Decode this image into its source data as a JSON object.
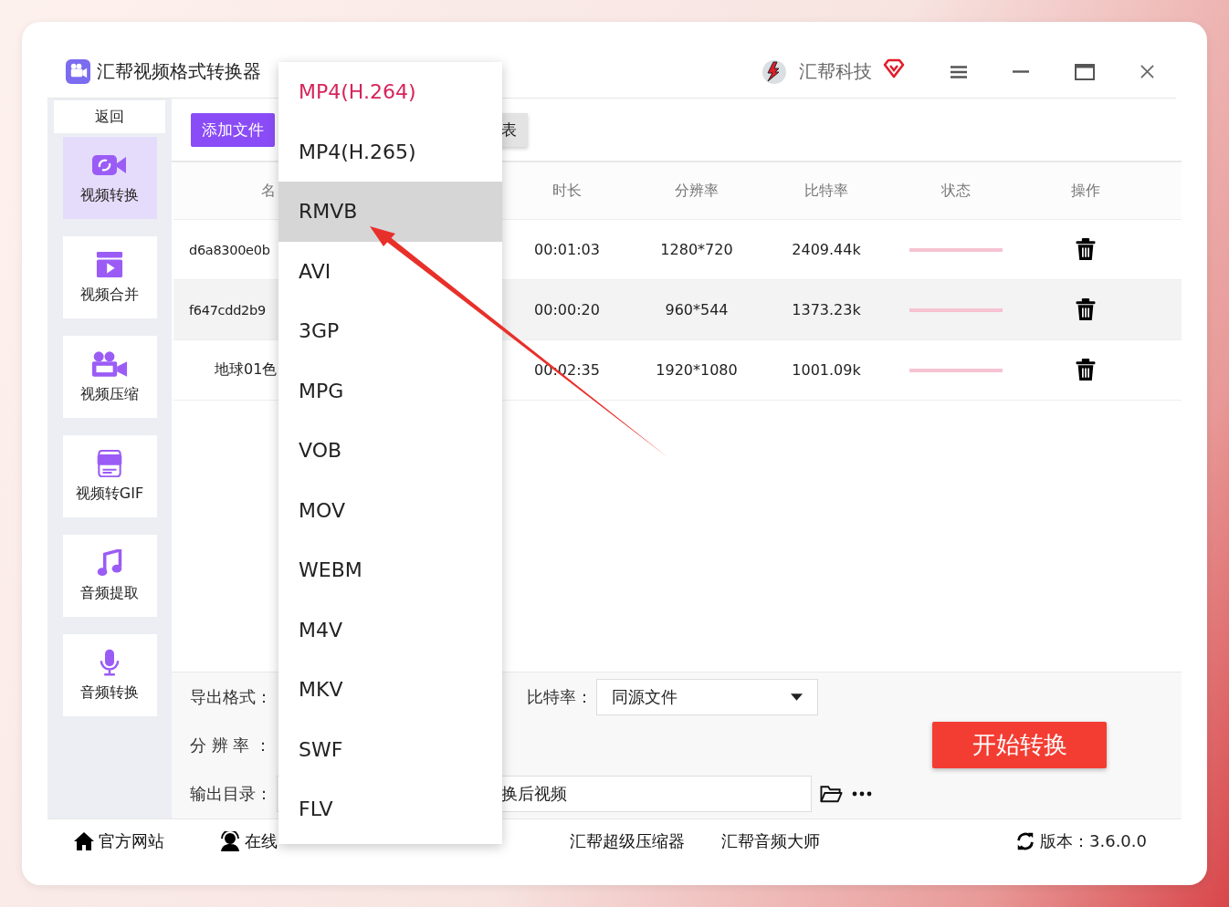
{
  "window": {
    "title": "汇帮视频格式转换器",
    "brand": "汇帮科技"
  },
  "sidebar": {
    "back": "返回",
    "items": [
      {
        "label": "视频转换",
        "kind": "convert",
        "selected": true
      },
      {
        "label": "视频合并",
        "kind": "merge",
        "selected": false
      },
      {
        "label": "视频压缩",
        "kind": "camera",
        "selected": false
      },
      {
        "label": "视频转GIF",
        "kind": "gif",
        "selected": false
      },
      {
        "label": "音频提取",
        "kind": "music",
        "selected": false
      },
      {
        "label": "音频转换",
        "kind": "mic",
        "selected": false
      }
    ]
  },
  "toolbar": {
    "buttons": [
      {
        "label": "添加文件",
        "kind": "primary"
      },
      {
        "label": "表",
        "kind": "secondary"
      }
    ]
  },
  "table": {
    "columns": [
      "名",
      "时长",
      "分辨率",
      "比特率",
      "状态",
      "操作"
    ],
    "rows": [
      {
        "name": "d6a8300e0b",
        "duration": "00:01:03",
        "resolution": "1280*720",
        "bitrate": "2409.44k"
      },
      {
        "name": "f647cdd2b9",
        "duration": "00:00:20",
        "resolution": "960*544",
        "bitrate": "1373.23k"
      },
      {
        "name": "地球01色",
        "duration": "00:02:35",
        "resolution": "1920*1080",
        "bitrate": "1001.09k"
      }
    ]
  },
  "settings": {
    "format_label": "导出格式：",
    "bitrate_label": "比特率：",
    "bitrate_value": "同源文件",
    "resolution_label": "分 辨 率 ：",
    "output_label": "输出目录：",
    "output_value": "换后视频",
    "start": "开始转换"
  },
  "footer": {
    "links": [
      {
        "label": "官方网站",
        "kind": "home"
      },
      {
        "label": "在线",
        "kind": "person"
      },
      {
        "label": "汇帮超级压缩器"
      },
      {
        "label": "汇帮音频大师"
      }
    ],
    "version": "版本：3.6.0.0"
  },
  "dropdown": {
    "items": [
      {
        "label": "MP4(H.264)",
        "selected": true,
        "highlighted": false
      },
      {
        "label": "MP4(H.265)",
        "selected": false,
        "highlighted": false
      },
      {
        "label": "RMVB",
        "selected": false,
        "highlighted": true
      },
      {
        "label": "AVI",
        "selected": false,
        "highlighted": false
      },
      {
        "label": "3GP",
        "selected": false,
        "highlighted": false
      },
      {
        "label": "MPG",
        "selected": false,
        "highlighted": false
      },
      {
        "label": "VOB",
        "selected": false,
        "highlighted": false
      },
      {
        "label": "MOV",
        "selected": false,
        "highlighted": false
      },
      {
        "label": "WEBM",
        "selected": false,
        "highlighted": false
      },
      {
        "label": "M4V",
        "selected": false,
        "highlighted": false
      },
      {
        "label": "MKV",
        "selected": false,
        "highlighted": false
      },
      {
        "label": "SWF",
        "selected": false,
        "highlighted": false
      },
      {
        "label": "FLV",
        "selected": false,
        "highlighted": false
      }
    ]
  }
}
